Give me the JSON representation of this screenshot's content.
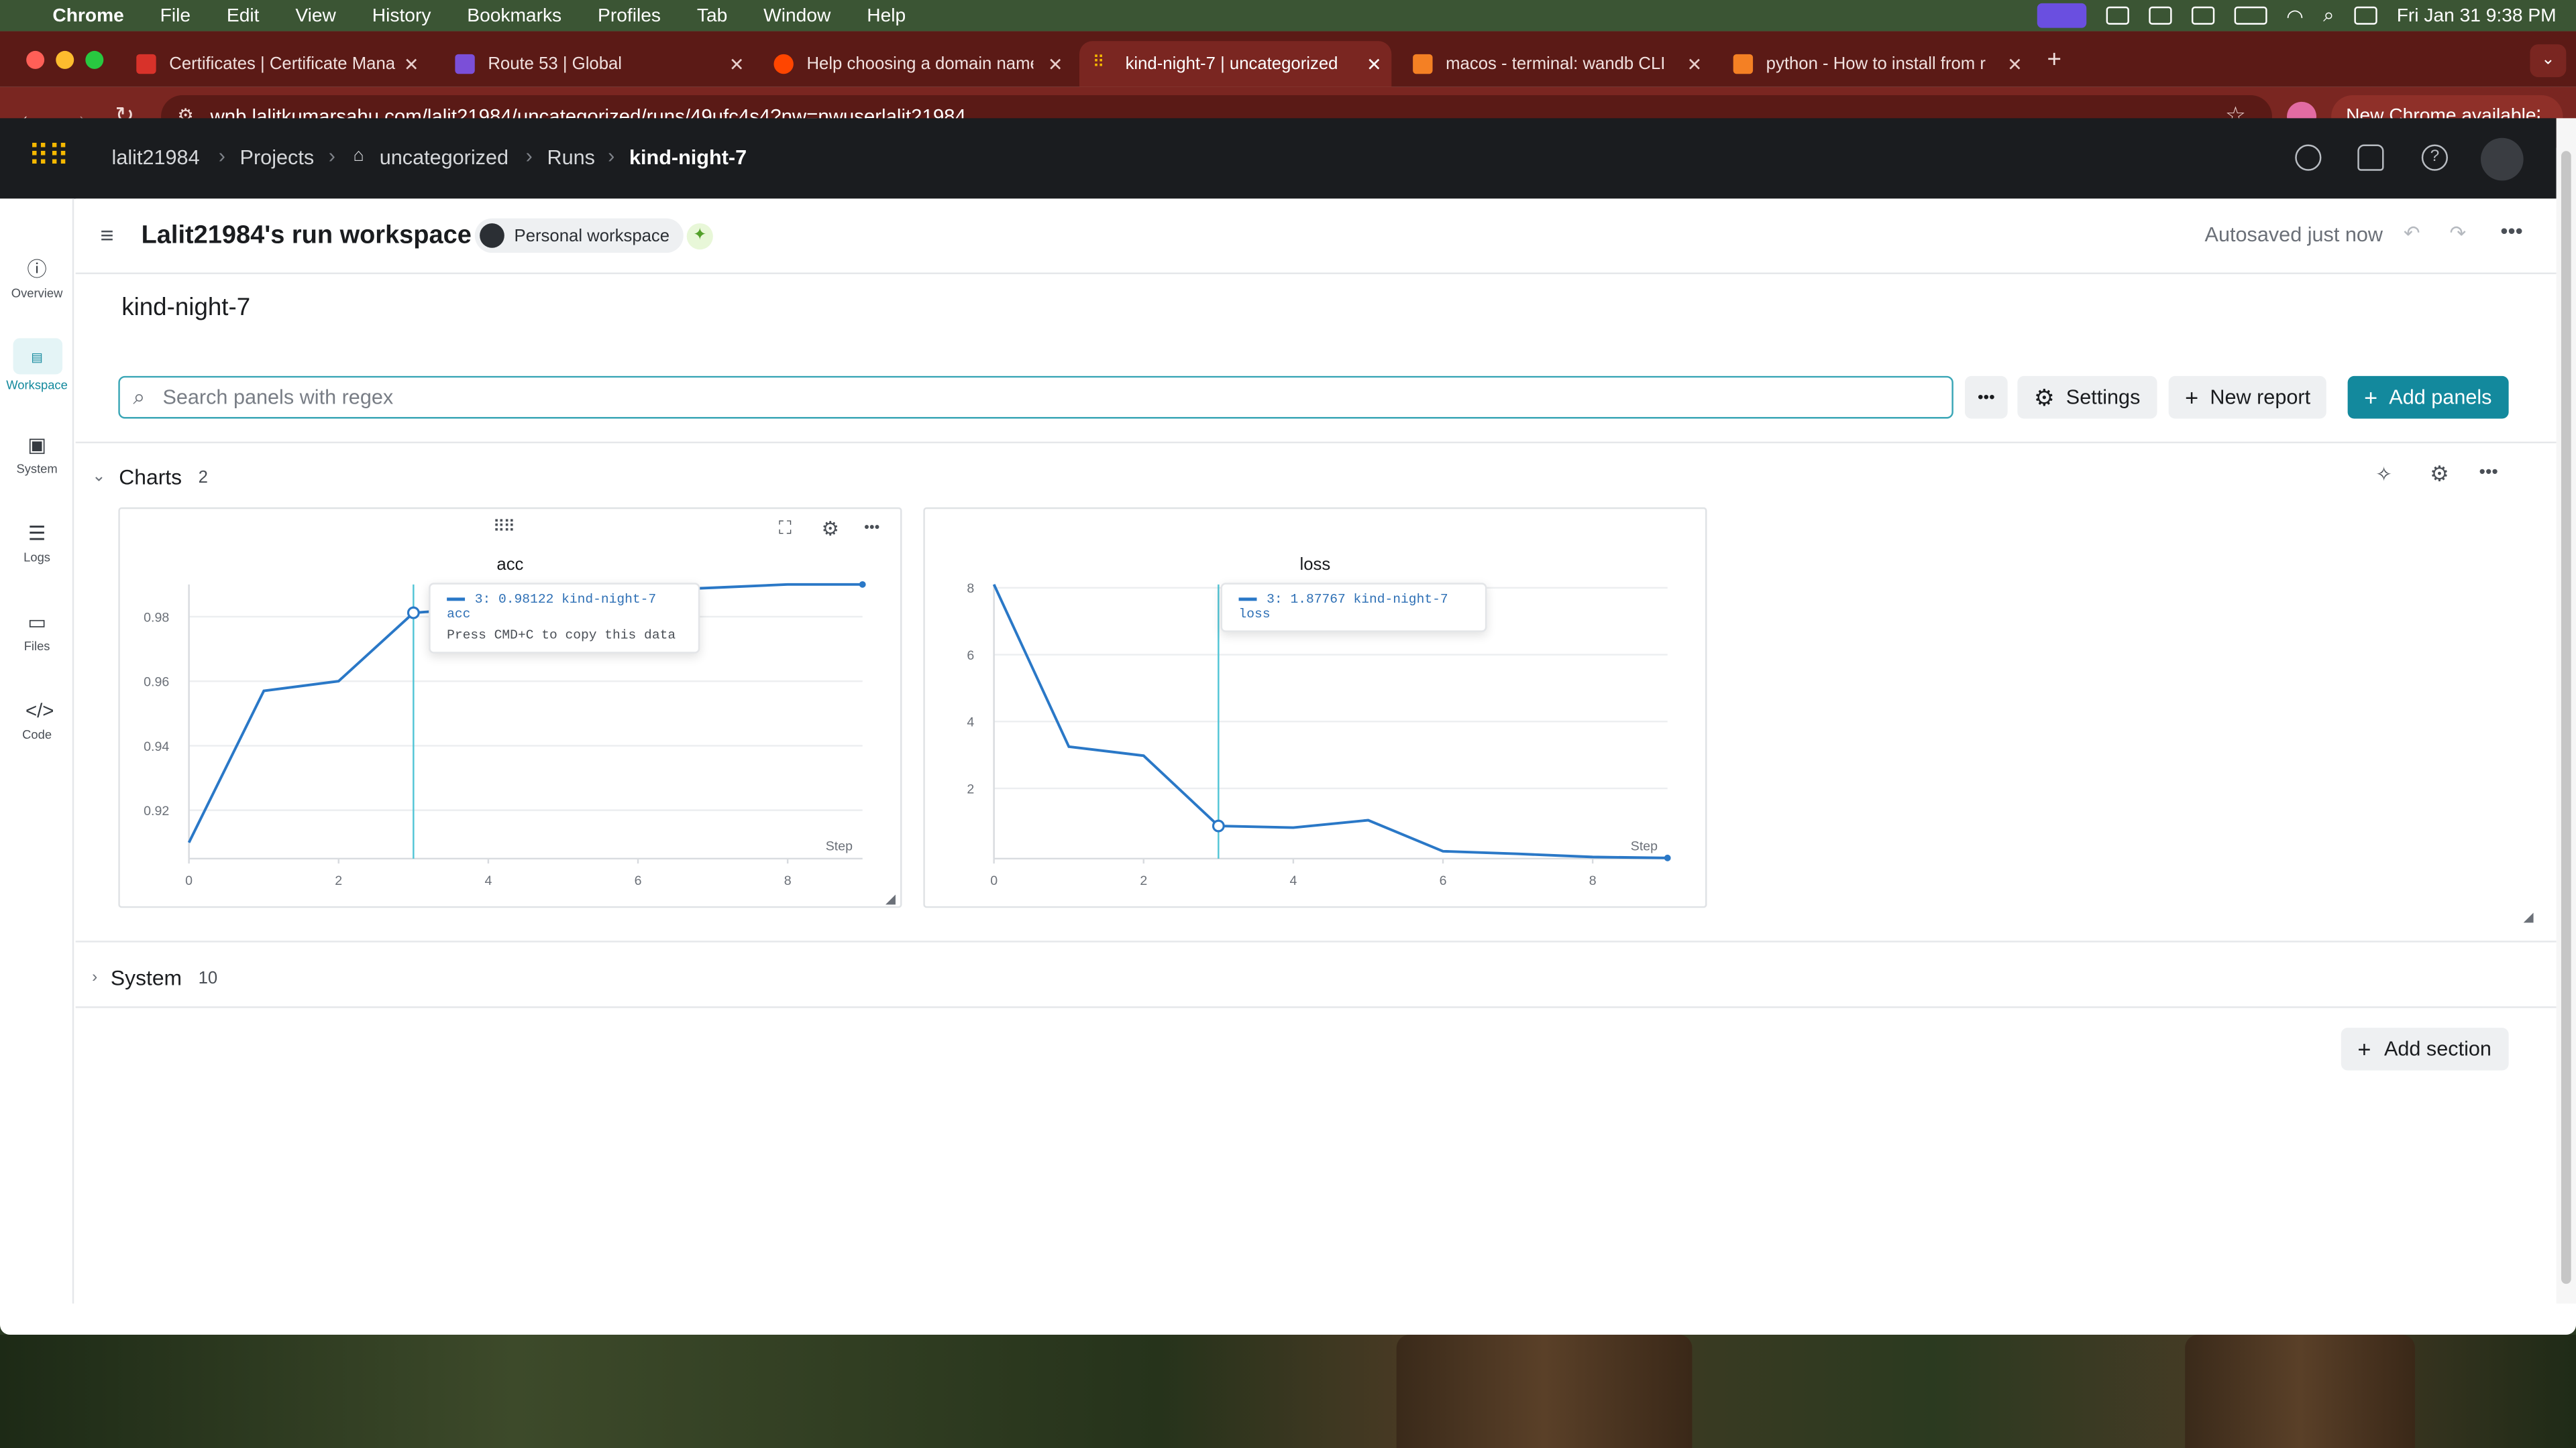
{
  "menubar": {
    "app": "Chrome",
    "items": [
      "File",
      "Edit",
      "View",
      "History",
      "Bookmarks",
      "Profiles",
      "Tab",
      "Window",
      "Help"
    ],
    "datetime": "Fri Jan 31  9:38 PM"
  },
  "tabs": [
    {
      "title": "Certificates | Certificate Mana",
      "icon_color": "#d8322a"
    },
    {
      "title": "Route 53 | Global",
      "icon_color": "#7b4fd8"
    },
    {
      "title": "Help choosing a domain name",
      "icon_color": "#ff4500"
    },
    {
      "title": "kind-night-7 | uncategorized",
      "icon_color": "#f5b800"
    },
    {
      "title": "macos - terminal: wandb CLI",
      "icon_color": "#f48024"
    },
    {
      "title": "python - How to install from r",
      "icon_color": "#f48024"
    }
  ],
  "address": {
    "url": "wnb.lalitkumarsahu.com/lalit21984/uncategorized/runs/49ufc4s4?nw=nwuserlalit21984",
    "update_label": "New Chrome available"
  },
  "breadcrumb": {
    "user": "lalit21984",
    "projects": "Projects",
    "project": "uncategorized",
    "runs": "Runs",
    "run": "kind-night-7"
  },
  "leftnav": [
    {
      "label": "Overview",
      "icon": "info-icon"
    },
    {
      "label": "Workspace",
      "icon": "workspace-icon"
    },
    {
      "label": "System",
      "icon": "chip-icon"
    },
    {
      "label": "Logs",
      "icon": "list-icon"
    },
    {
      "label": "Files",
      "icon": "file-icon"
    },
    {
      "label": "Code",
      "icon": "code-icon"
    }
  ],
  "workspace": {
    "title": "Lalit21984's run workspace",
    "badge": "Personal workspace",
    "autosave": "Autosaved just now",
    "run_name": "kind-night-7",
    "search_placeholder": "Search panels with regex",
    "settings_label": "Settings",
    "new_report_label": "New report",
    "add_panels_label": "Add panels",
    "add_section_label": "Add section"
  },
  "sections": {
    "charts": {
      "label": "Charts",
      "count": "2"
    },
    "system": {
      "label": "System",
      "count": "10"
    }
  },
  "colors": {
    "accent": "#13899d",
    "line": "#2a78c7",
    "crosshair": "#52c5d6"
  },
  "chart_data": [
    {
      "type": "line",
      "title": "acc",
      "xlabel": "Step",
      "x": [
        0,
        1,
        2,
        3,
        4,
        5,
        6,
        7,
        8,
        9
      ],
      "series": [
        {
          "values": [
            0.91,
            0.957,
            0.96,
            0.98122,
            0.983,
            0.986,
            0.988,
            0.989,
            0.99,
            0.99
          ]
        }
      ],
      "xlim": [
        0,
        9
      ],
      "ylim": [
        0.905,
        0.99
      ],
      "xticks": [
        0,
        2,
        4,
        6,
        8
      ],
      "yticks": [
        "0.92",
        "0.94",
        "0.96",
        "0.98"
      ],
      "hover": {
        "step": 3,
        "text": "3: 0.98122 kind-night-7 acc",
        "hint": "Press CMD+C to copy this data"
      }
    },
    {
      "type": "line",
      "title": "loss",
      "xlabel": "Step",
      "x": [
        0,
        1,
        2,
        3,
        4,
        5,
        6,
        7,
        8,
        9
      ],
      "series": [
        {
          "values": [
            8.1,
            3.25,
            2.98,
            0.87767,
            0.83,
            1.05,
            0.12,
            0.04,
            -0.05,
            -0.08
          ]
        }
      ],
      "xlim": [
        0,
        9
      ],
      "ylim": [
        -0.1,
        8.1
      ],
      "xticks": [
        0,
        2,
        4,
        6,
        8
      ],
      "yticks": [
        "2",
        "4",
        "6",
        "8"
      ],
      "hover": {
        "step": 3,
        "text": "3: 1.87767 kind-night-7 loss"
      }
    }
  ]
}
